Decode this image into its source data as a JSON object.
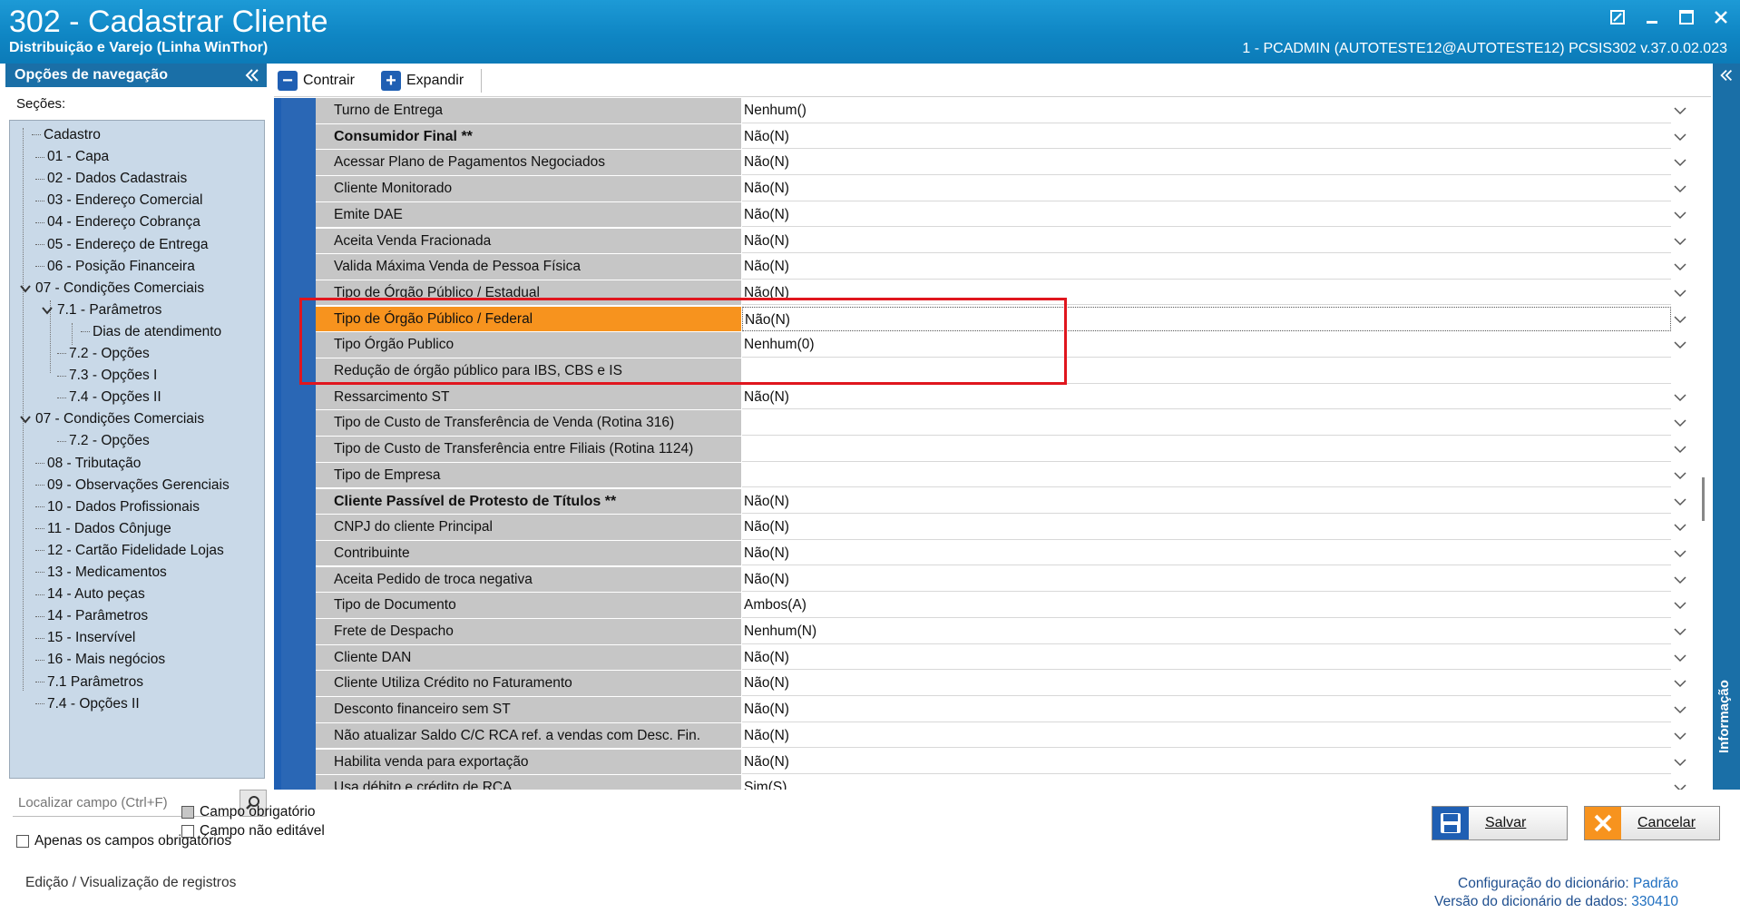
{
  "window": {
    "title": "302 - Cadastrar Cliente",
    "subtitle": "Distribuição e Varejo (Linha WinThor)",
    "user_info": "1 - PCADMIN (AUTOTESTE12@AUTOTESTE12)   PCSIS302  v.37.0.02.023"
  },
  "nav": {
    "header": "Opções de navegação",
    "sections_label": "Seções:",
    "items": [
      {
        "label": "Cadastro"
      },
      {
        "label": "01 - Capa"
      },
      {
        "label": "02 - Dados Cadastrais"
      },
      {
        "label": "03 - Endereço Comercial"
      },
      {
        "label": "04 - Endereço Cobrança"
      },
      {
        "label": "05 - Endereço de Entrega"
      },
      {
        "label": "06 - Posição Financeira"
      },
      {
        "label": "07 - Condições Comerciais"
      },
      {
        "label": "7.1 - Parâmetros"
      },
      {
        "label": "Dias de atendimento"
      },
      {
        "label": "7.2 - Opções"
      },
      {
        "label": "7.3 - Opções I"
      },
      {
        "label": "7.4 - Opções II"
      },
      {
        "label": "07 - Condições Comerciais"
      },
      {
        "label": "7.2 - Opções"
      },
      {
        "label": "08 - Tributação"
      },
      {
        "label": "09 - Observações Gerenciais"
      },
      {
        "label": "10 - Dados Profissionais"
      },
      {
        "label": "11 - Dados Cônjuge"
      },
      {
        "label": "12 - Cartão Fidelidade Lojas"
      },
      {
        "label": "13 - Medicamentos"
      },
      {
        "label": "14 - Auto peças"
      },
      {
        "label": "14 - Parâmetros"
      },
      {
        "label": "15 - Inservível"
      },
      {
        "label": "16 - Mais negócios"
      },
      {
        "label": "7.1 Parâmetros"
      },
      {
        "label": "7.4 - Opções II"
      }
    ],
    "search_placeholder": "Localizar campo (Ctrl+F)",
    "required_only_label": "Apenas os campos obrigatórios"
  },
  "toolbar": {
    "collapse_label": "Contrair",
    "expand_label": "Expandir"
  },
  "grid": {
    "rows": [
      {
        "label": "Turno de Entrega",
        "value": "Nenhum()",
        "dropdown": true
      },
      {
        "label": "Consumidor Final **",
        "value": "Não(N)",
        "dropdown": true
      },
      {
        "label": "Acessar Plano de Pagamentos Negociados",
        "value": "Não(N)",
        "dropdown": true
      },
      {
        "label": "Cliente Monitorado",
        "value": "Não(N)",
        "dropdown": true
      },
      {
        "label": "Emite DAE",
        "value": "Não(N)",
        "dropdown": true
      },
      {
        "label": "Aceita Venda Fracionada",
        "value": "Não(N)",
        "dropdown": true
      },
      {
        "label": "Valida Máxima Venda de Pessoa Física",
        "value": "Não(N)",
        "dropdown": true
      },
      {
        "label": "Tipo de Órgão Público / Estadual",
        "value": "Não(N)",
        "dropdown": true
      },
      {
        "label": "Tipo de Órgão Público / Federal",
        "value": "Não(N)",
        "dropdown": true
      },
      {
        "label": "Tipo Órgão Publico",
        "value": "Nenhum(0)",
        "dropdown": true
      },
      {
        "label": "Redução de órgão público para IBS, CBS e IS",
        "value": "",
        "dropdown": false
      },
      {
        "label": "Ressarcimento ST",
        "value": "Não(N)",
        "dropdown": true
      },
      {
        "label": "Tipo de Custo de Transferência de Venda (Rotina 316)",
        "value": "",
        "dropdown": true
      },
      {
        "label": "Tipo de Custo de Transferência entre Filiais (Rotina 1124)",
        "value": "",
        "dropdown": true
      },
      {
        "label": "Tipo de Empresa",
        "value": "",
        "dropdown": true
      },
      {
        "label": "Cliente Passível de Protesto de Títulos **",
        "value": "Não(N)",
        "dropdown": true
      },
      {
        "label": "CNPJ do cliente Principal",
        "value": "Não(N)",
        "dropdown": true
      },
      {
        "label": "Contribuinte",
        "value": "Não(N)",
        "dropdown": true
      },
      {
        "label": "Aceita Pedido de troca negativa",
        "value": "Não(N)",
        "dropdown": true
      },
      {
        "label": "Tipo de Documento",
        "value": "Ambos(A)",
        "dropdown": true
      },
      {
        "label": "Frete de Despacho",
        "value": "Nenhum(N)",
        "dropdown": true
      },
      {
        "label": "Cliente DAN",
        "value": "Não(N)",
        "dropdown": true
      },
      {
        "label": "Cliente Utiliza Crédito no Faturamento",
        "value": "Não(N)",
        "dropdown": true
      },
      {
        "label": "Desconto financeiro sem ST",
        "value": "Não(N)",
        "dropdown": true
      },
      {
        "label": "Não atualizar Saldo C/C RCA ref. a vendas com Desc. Fin.",
        "value": "Não(N)",
        "dropdown": true
      },
      {
        "label": "Habilita venda para exportação",
        "value": "Não(N)",
        "dropdown": true
      },
      {
        "label": "Usa débito e crédito de RCA",
        "value": "Sim(S)",
        "dropdown": true
      }
    ]
  },
  "side_panel": {
    "title": "Informação"
  },
  "legend": {
    "required": "Campo obrigatório",
    "not_editable": "Campo não editável"
  },
  "actions": {
    "save_label": "Salvar",
    "cancel_label": "Cancelar"
  },
  "footer": {
    "mode": "Edição / Visualização de registros",
    "dict_config_label": "Configuração do dicionário:",
    "dict_config_value": "Padrão",
    "dict_version_label": "Versão do dicionário de dados:",
    "dict_version_value": "330410"
  },
  "colors": {
    "titlebar": "#1590cf",
    "nav_header": "#1a6fa7",
    "tree_bg": "#c9d9e8",
    "row_label_bg": "#c6c6c6",
    "highlight": "#f7931e",
    "annotation_box": "#e0161e"
  },
  "icons": {
    "toolbar": [
      "minus-icon",
      "plus-icon"
    ],
    "window": [
      "restore-icon",
      "minimize-icon",
      "maximize-icon",
      "close-icon"
    ],
    "actions": [
      "floppy-disk-icon",
      "x-icon"
    ]
  }
}
